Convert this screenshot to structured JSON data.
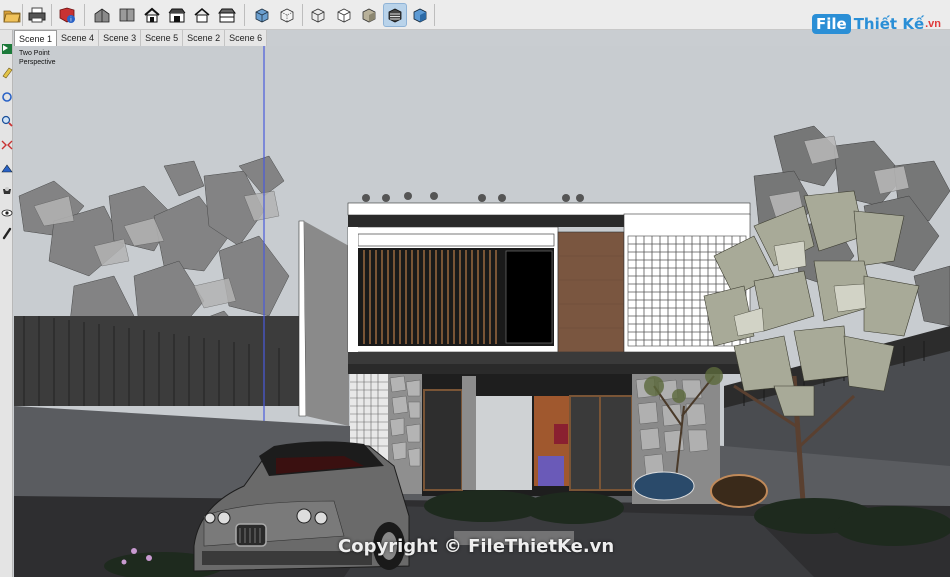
{
  "toolbar": {
    "buttons": [
      {
        "name": "open-icon"
      },
      {
        "name": "print-icon"
      },
      {
        "name": "model-info-icon"
      },
      {
        "name": "iso-view-icon"
      },
      {
        "name": "top-view-icon"
      },
      {
        "name": "front-view-icon"
      },
      {
        "name": "right-view-icon"
      },
      {
        "name": "back-view-icon"
      },
      {
        "name": "left-view-icon"
      },
      {
        "name": "xray-icon"
      },
      {
        "name": "back-edges-icon"
      },
      {
        "name": "wireframe-icon"
      },
      {
        "name": "hidden-line-icon"
      },
      {
        "name": "shaded-icon"
      },
      {
        "name": "shaded-textures-icon"
      },
      {
        "name": "monochrome-icon"
      }
    ],
    "active_style": "shaded-textures-icon"
  },
  "logo": {
    "file": "File",
    "rest": "Thiết Kế",
    "vn": ".vn"
  },
  "scene_tabs": [
    {
      "label": "Scene 1",
      "active": true
    },
    {
      "label": "Scene 4",
      "active": false
    },
    {
      "label": "Scene 3",
      "active": false
    },
    {
      "label": "Scene 5",
      "active": false
    },
    {
      "label": "Scene 2",
      "active": false
    },
    {
      "label": "Scene 6",
      "active": false
    }
  ],
  "viewport": {
    "projection_line1": "Two Point",
    "projection_line2": "Perspective",
    "watermark": "Copyright © FileThietKe.vn"
  },
  "left_tools": [
    "select-icon",
    "paint-icon",
    "orbit-icon",
    "zoom-icon",
    "zoom-extents-icon",
    "pan-icon",
    "walk-icon",
    "look-icon",
    "position-camera-icon"
  ],
  "colors": {
    "accent": "#2b8fd6",
    "active_tab": "#ffffff",
    "toolbar": "#ececec"
  }
}
